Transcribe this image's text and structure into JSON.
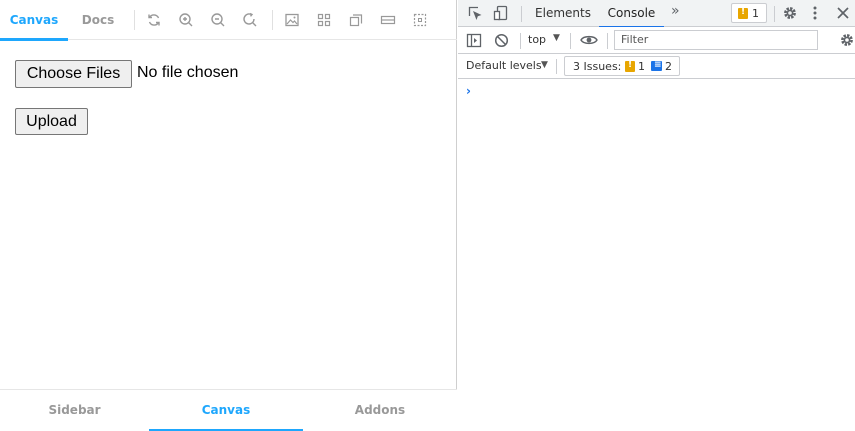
{
  "storybook": {
    "top_tabs": [
      {
        "label": "Canvas",
        "active": true
      },
      {
        "label": "Docs",
        "active": false
      }
    ],
    "toolbar_icons": [
      "reload-icon",
      "zoom-in-icon",
      "zoom-out-icon",
      "zoom-reset-icon",
      "background-icon",
      "grid-icon",
      "viewport-icon",
      "measure-icon",
      "outline-icon"
    ],
    "canvas": {
      "choose_files_label": "Choose Files",
      "file_status": "No file chosen",
      "upload_label": "Upload"
    },
    "bottom_tabs": [
      {
        "label": "Sidebar",
        "active": false
      },
      {
        "label": "Canvas",
        "active": true
      },
      {
        "label": "Addons",
        "active": false
      }
    ],
    "accent_color": "#1ea7fd"
  },
  "devtools": {
    "tabs": [
      {
        "label": "Elements",
        "active": false
      },
      {
        "label": "Console",
        "active": true
      }
    ],
    "more_tabs": "»",
    "warning_count": "1",
    "context": "top",
    "filter_placeholder": "Filter",
    "levels": "Default levels",
    "issues_label": "3 Issues:",
    "issues_warning_count": "1",
    "issues_info_count": "2",
    "prompt": "›"
  }
}
